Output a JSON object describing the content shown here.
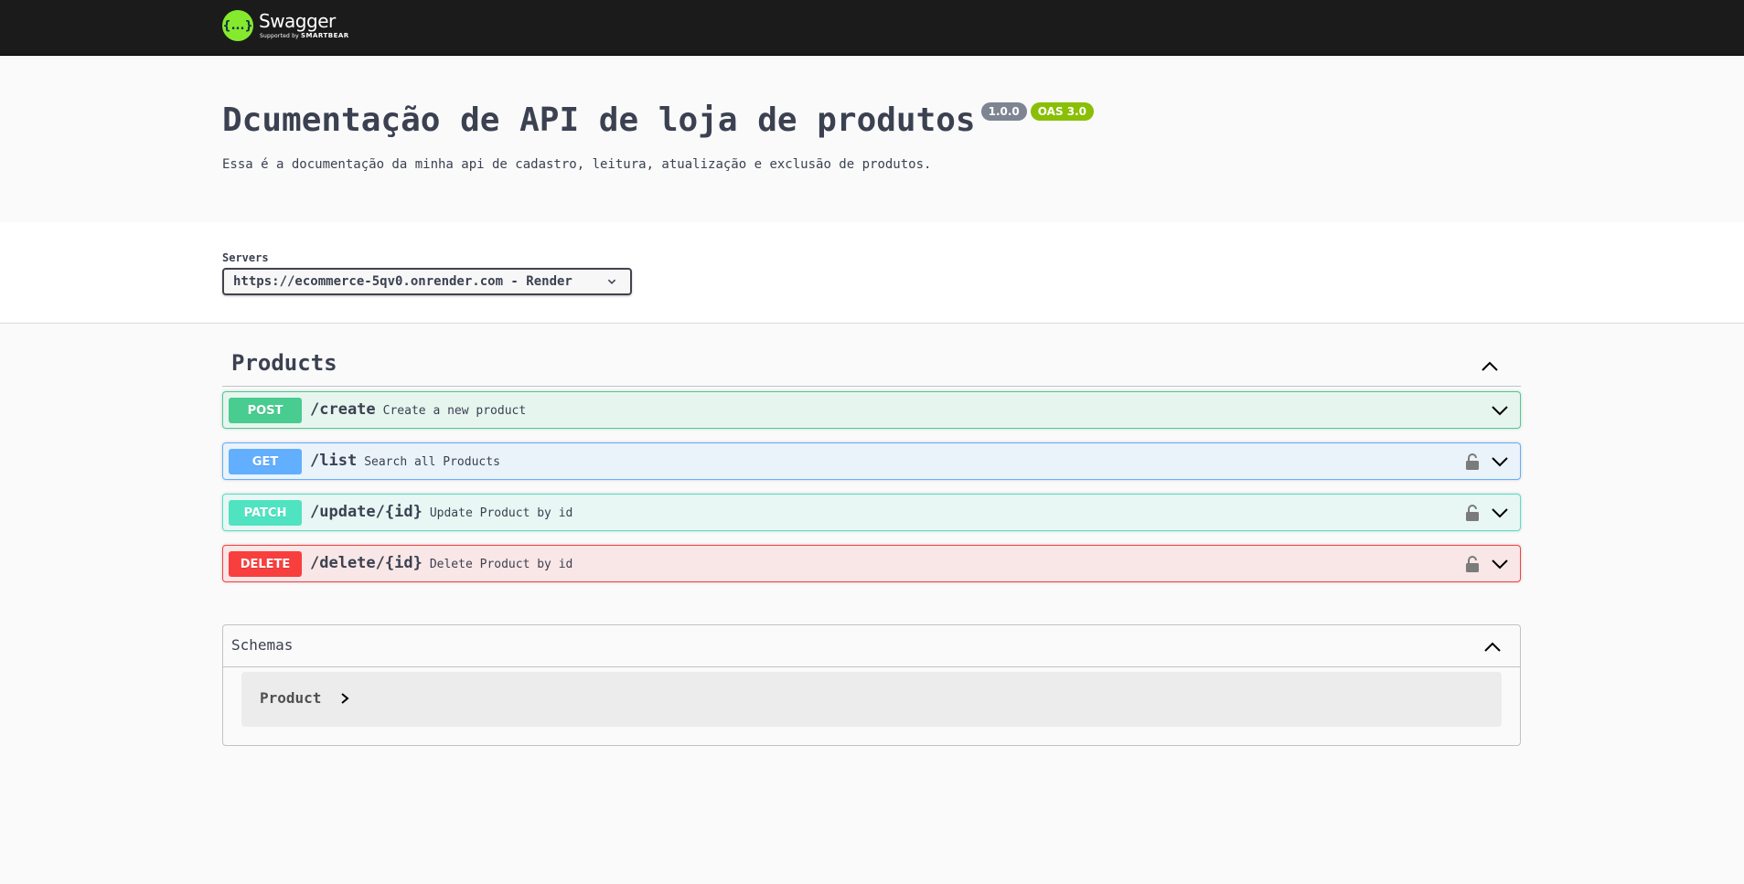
{
  "brand": {
    "logo_glyph": "{...}",
    "name": "Swagger",
    "supported_by": "Supported by",
    "company": "SMARTBEAR",
    "accent_color": "#85ea2d"
  },
  "info": {
    "title": "Dcumentação de API de loja de produtos",
    "version": "1.0.0",
    "oas": "OAS 3.0",
    "description": "Essa é a documentação da minha api de cadastro, leitura, atualização e exclusão de produtos."
  },
  "servers": {
    "label": "Servers",
    "selected": "https://ecommerce-5qv0.onrender.com - Render"
  },
  "tag": {
    "name": "Products",
    "expanded": true
  },
  "operations": [
    {
      "method": "POST",
      "path": "/create",
      "summary": "Create a new product",
      "locked": false,
      "color": "#49cc90"
    },
    {
      "method": "GET",
      "path": "/list",
      "summary": "Search all Products",
      "locked": true,
      "color": "#61affe"
    },
    {
      "method": "PATCH",
      "path": "/update/{id}",
      "summary": "Update Product by id",
      "locked": true,
      "color": "#50e3c2"
    },
    {
      "method": "DELETE",
      "path": "/delete/{id}",
      "summary": "Delete Product by id",
      "locked": true,
      "color": "#f93e3e"
    }
  ],
  "schemas": {
    "title": "Schemas",
    "expanded": true,
    "models": [
      {
        "name": "Product"
      }
    ]
  }
}
